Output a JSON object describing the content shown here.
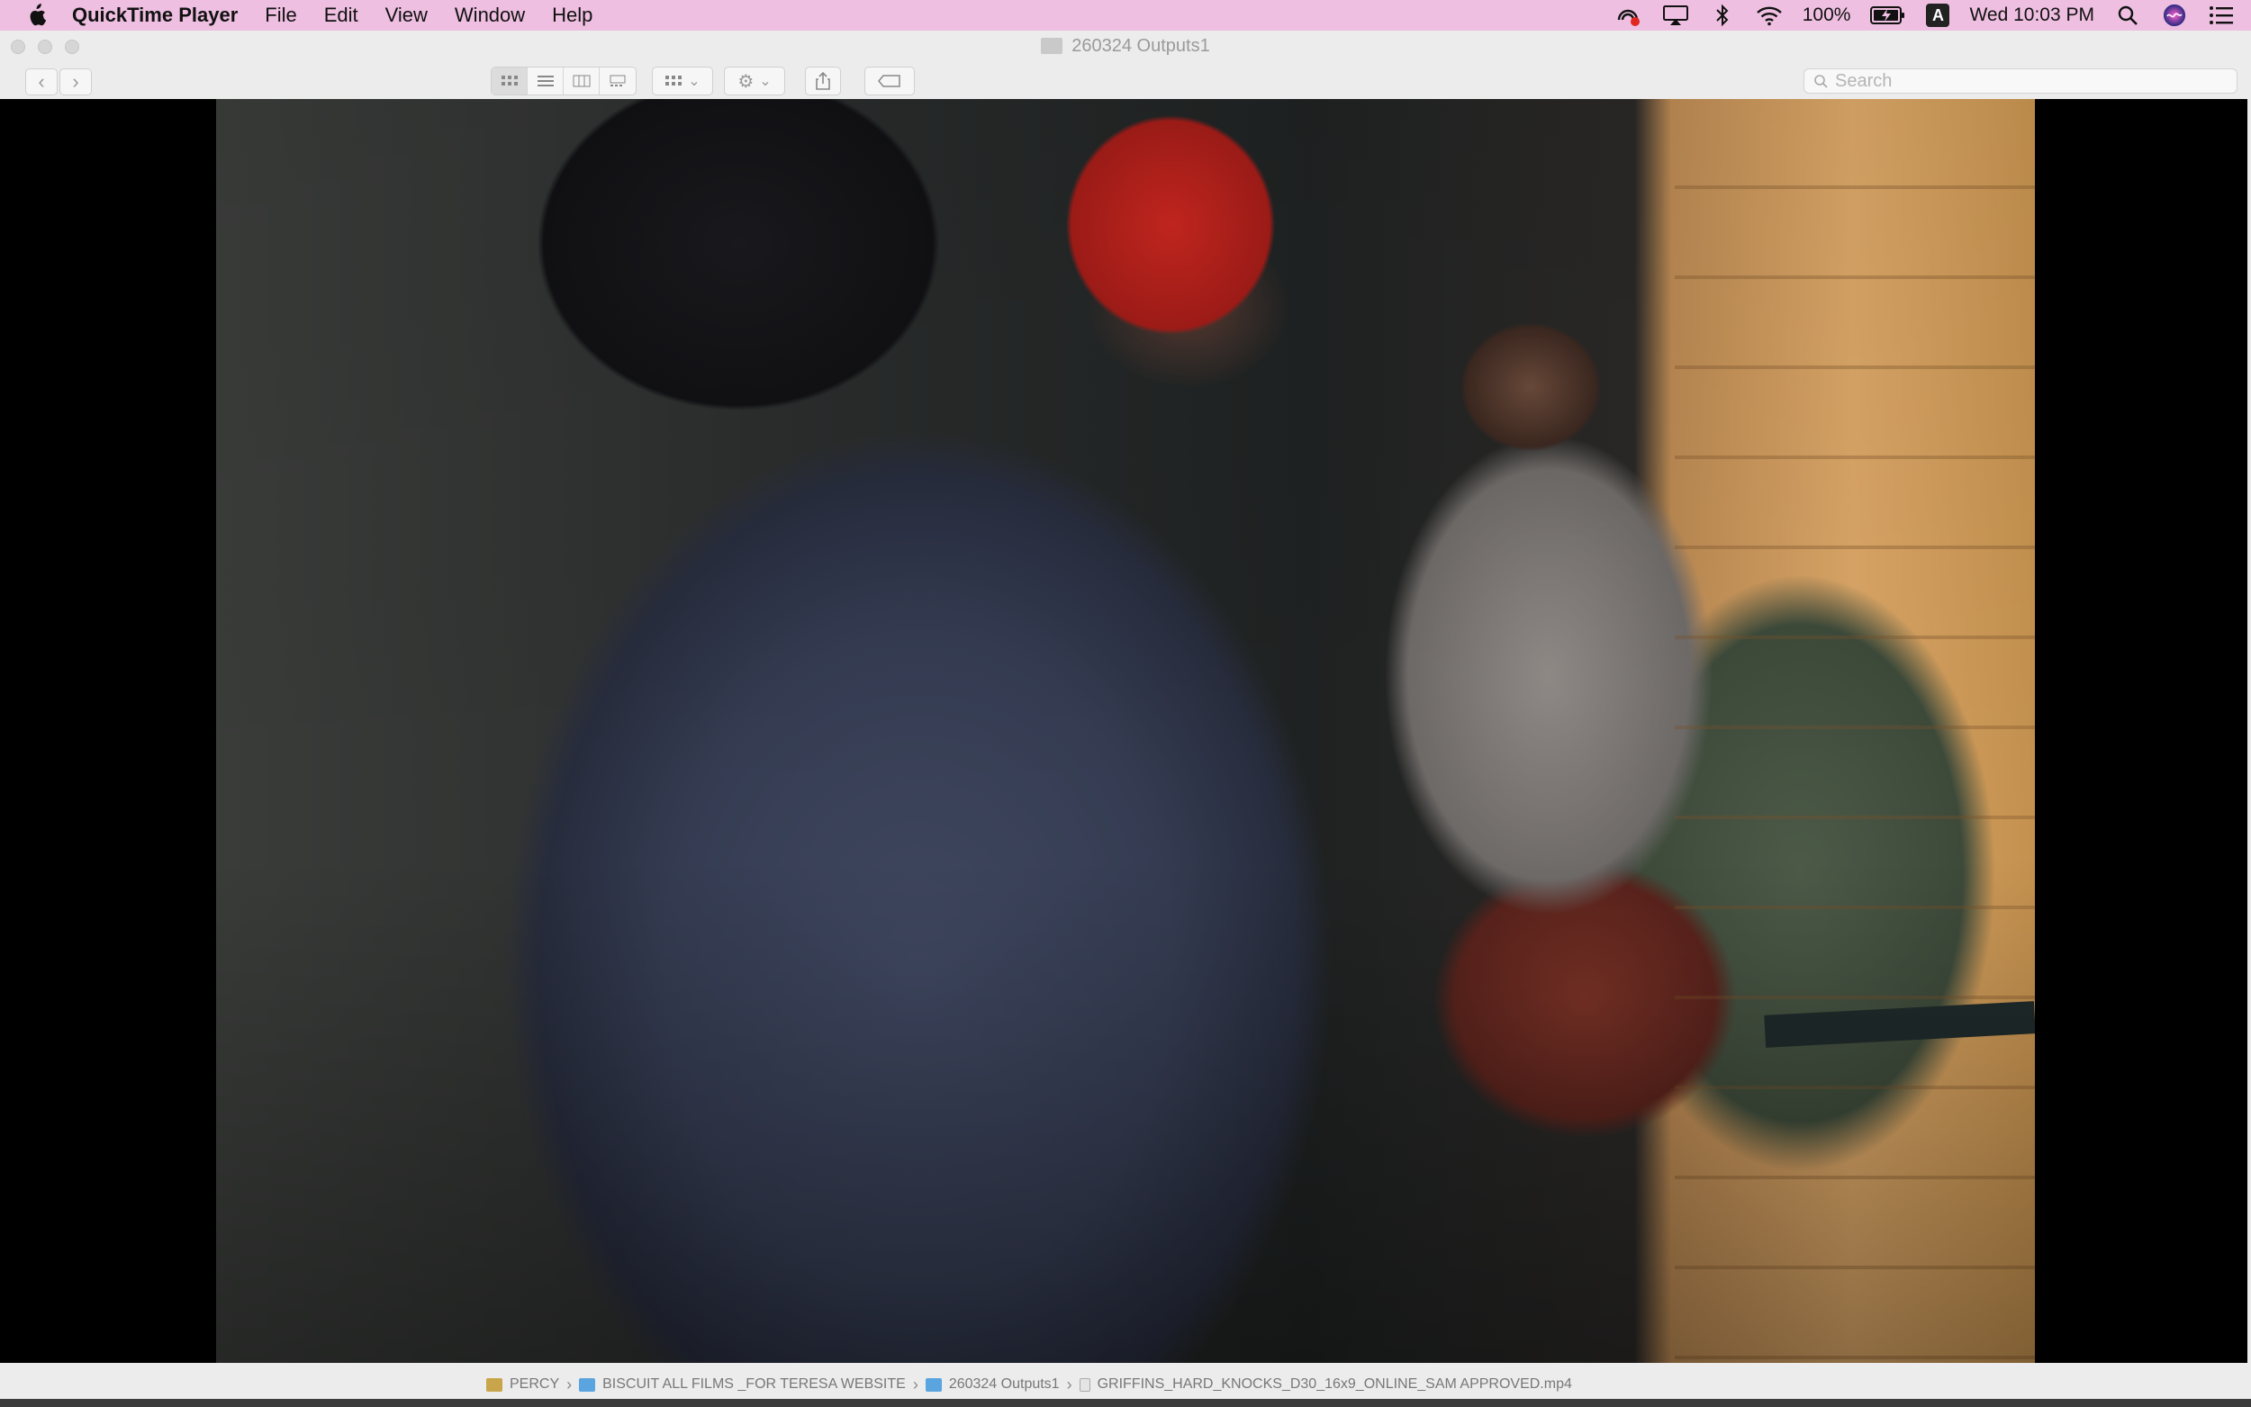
{
  "menubar": {
    "app_name": "QuickTime Player",
    "items": [
      "File",
      "Edit",
      "View",
      "Window",
      "Help"
    ],
    "battery": "100%",
    "clock": "Wed 10:03 PM",
    "input_badge": "A"
  },
  "finder": {
    "title": "260324 Outputs1",
    "search_placeholder": "Search"
  },
  "pathbar": {
    "crumbs": [
      {
        "label": "PERCY",
        "icon": "drive-icon"
      },
      {
        "label": "BISCUIT ALL FILMS _FOR TERESA WEBSITE",
        "icon": "folder-icon"
      },
      {
        "label": "260324 Outputs1",
        "icon": "folder-icon"
      },
      {
        "label": "GRIFFINS_HARD_KNOCKS_D30_16x9_ONLINE_SAM APPROVED.mp4",
        "icon": "movie-file-icon"
      }
    ]
  },
  "colors": {
    "menubar_bg": "#eebfe0",
    "folder_blue": "#5aa4e0",
    "drive_yellow": "#c8a44a"
  }
}
